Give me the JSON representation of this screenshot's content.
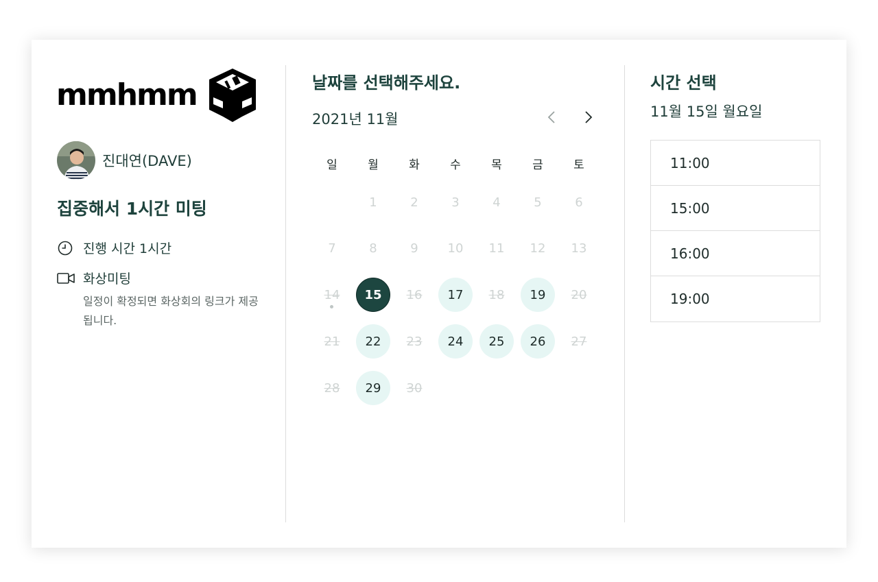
{
  "brand": {
    "logo_text": "mmhmm"
  },
  "host": {
    "name": "진대연(DAVE)"
  },
  "event": {
    "title": "집중해서 1시간 미팅",
    "duration_label": "진행 시간 1시간",
    "meeting_type_label": "화상미팅",
    "meeting_note": "일정이 확정되면 화상회의 링크가 제공됩니다."
  },
  "calendar": {
    "heading": "날짜를 선택해주세요.",
    "month_label": "2021년 11월",
    "weekdays": [
      "일",
      "월",
      "화",
      "수",
      "목",
      "금",
      "토"
    ],
    "selected_day": "15",
    "available_days": [
      "17",
      "19",
      "22",
      "24",
      "25",
      "26",
      "29"
    ],
    "struck_days": [
      "14",
      "16",
      "18",
      "20",
      "21",
      "23",
      "27",
      "28",
      "30"
    ],
    "disabled_days": [
      "1",
      "2",
      "3",
      "4",
      "5",
      "6",
      "7",
      "8",
      "9",
      "10",
      "11",
      "12",
      "13"
    ],
    "today": "14"
  },
  "time_panel": {
    "heading": "시간 선택",
    "selected_date_label": "11월 15일 월요일",
    "slots": [
      "11:00",
      "15:00",
      "16:00",
      "19:00"
    ]
  },
  "colors": {
    "accent_dark": "#1d4640",
    "available_bg": "#e6f6f4",
    "heading": "#1d433d"
  }
}
